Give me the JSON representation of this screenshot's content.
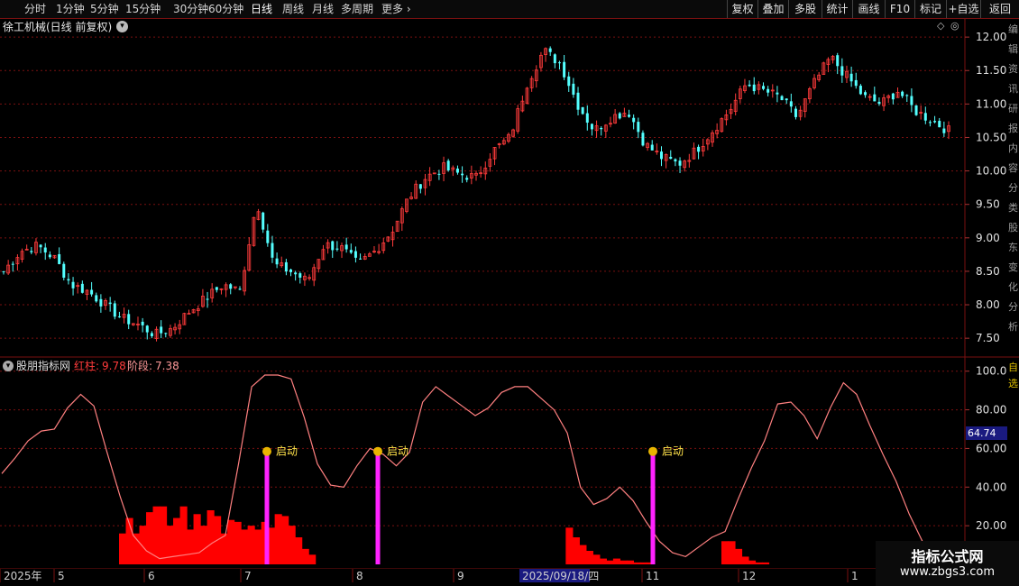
{
  "toolbar": {
    "periods": [
      "分时",
      "1分钟",
      "5分钟",
      "15分钟",
      "30分钟",
      "60分钟",
      "日线",
      "周线",
      "月线",
      "多周期",
      "更多"
    ],
    "active_period": "日线",
    "right_buttons": [
      "复权",
      "叠加",
      "多股",
      "统计",
      "画线",
      "F10",
      "标记",
      "+自选",
      "返回"
    ]
  },
  "main_chart": {
    "title": "徐工机械(日线 前复权)",
    "y_ticks": [
      "12.00",
      "11.50",
      "11.00",
      "10.50",
      "10.00",
      "9.50",
      "9.00",
      "8.50",
      "8.00",
      "7.50"
    ],
    "right_side_text": "编辑资讯研报内容分类股东变化分析"
  },
  "indicator": {
    "name": "股朋指标网",
    "red_bar_label": "红柱:",
    "red_bar_value": "9.78",
    "stage_label": "阶段:",
    "stage_value": "7.38",
    "y_ticks": [
      "100.0",
      "80.00",
      "60.00",
      "40.00",
      "20.00"
    ],
    "current_value": "64.74",
    "signal_label": "启动",
    "right_side_text": "自选"
  },
  "x_axis": {
    "labels": [
      "2025年",
      "5",
      "6",
      "7",
      "8",
      "9",
      "2025/09/18/四",
      "11",
      "12",
      "1"
    ],
    "highlight": "2025/09/18/四"
  },
  "watermark": {
    "line1": "指标公式网",
    "line2": "www.zbgs3.com"
  },
  "colors": {
    "up": "#ff3b3b",
    "down": "#54ffff",
    "stage_line": "#ff8080",
    "red_bars": "#ff0000",
    "signal": "#ff22ff",
    "grid": "#7a1010",
    "accent_box": "#1a1a80"
  },
  "chart_data": [
    {
      "type": "candlestick",
      "title": "徐工机械(日线 前复权)",
      "ylim": [
        7.3,
        12.15
      ],
      "x_labels": [
        "2025年",
        "5",
        "6",
        "7",
        "8",
        "9",
        "2025/09/18/四",
        "11",
        "12",
        "1"
      ],
      "close_approx": [
        8.5,
        8.8,
        8.88,
        8.7,
        8.3,
        8.2,
        8.0,
        7.8,
        7.7,
        7.55,
        7.65,
        7.9,
        8.1,
        8.3,
        8.2,
        9.55,
        8.6,
        8.5,
        8.35,
        8.9,
        8.85,
        8.6,
        8.8,
        9.1,
        9.6,
        9.9,
        10.05,
        9.95,
        9.9,
        10.3,
        10.5,
        11.3,
        11.8,
        11.6,
        11.0,
        10.6,
        10.8,
        10.9,
        10.4,
        10.2,
        10.1,
        10.3,
        10.6,
        10.9,
        11.3,
        11.2,
        11.1,
        10.8,
        11.3,
        11.7,
        11.4,
        11.1,
        11.0,
        11.2,
        10.9,
        10.75,
        10.6
      ],
      "volume_signals": [
        "7",
        "8",
        "11"
      ]
    },
    {
      "type": "line",
      "name": "阶段",
      "ylim": [
        0,
        105
      ],
      "current": 64.74,
      "values": [
        47,
        55,
        64,
        69,
        70,
        81,
        88,
        82,
        58,
        35,
        15,
        7,
        3,
        4,
        5,
        6,
        11,
        15,
        52,
        92,
        98,
        98,
        96,
        76,
        52,
        41,
        40,
        51,
        60,
        57,
        51,
        58,
        84,
        92,
        87,
        82,
        77,
        81,
        89,
        92,
        92,
        86,
        80,
        68,
        40,
        31,
        34,
        40,
        33,
        22,
        12,
        6,
        4,
        9,
        14,
        17,
        34,
        50,
        64,
        83,
        84,
        77,
        65,
        81,
        94,
        88,
        72,
        57,
        43,
        26,
        12,
        5,
        2
      ]
    },
    {
      "type": "bar",
      "name": "红柱",
      "current": 9.78,
      "values": [
        16,
        24,
        16,
        20,
        27,
        30,
        30,
        20,
        24,
        30,
        18,
        26,
        20,
        28,
        25,
        16,
        23,
        22,
        18,
        20,
        18,
        22,
        19,
        26,
        25,
        20,
        14,
        8,
        5,
        0,
        0,
        0,
        0,
        0,
        0,
        0,
        0,
        0,
        0,
        0,
        0,
        0,
        0,
        0,
        0,
        0,
        0,
        0,
        0,
        0,
        0,
        0,
        0,
        0,
        0,
        0,
        0,
        0,
        0,
        0,
        0,
        0,
        0,
        0,
        0,
        0,
        19,
        14,
        10,
        7,
        5,
        3,
        2,
        3,
        2,
        2,
        1,
        1,
        1,
        0,
        0,
        0,
        0,
        0,
        0,
        0,
        0,
        0,
        0,
        12,
        12,
        8,
        4,
        2,
        1,
        1,
        0
      ]
    }
  ]
}
